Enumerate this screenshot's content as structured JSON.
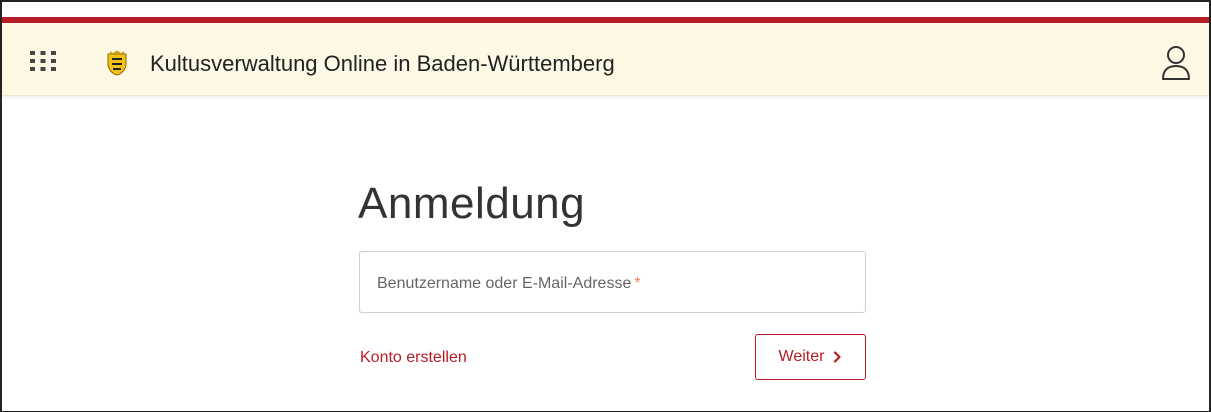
{
  "header": {
    "title": "Kultusverwaltung Online in Baden-Württemberg",
    "apps_icon": "apps-grid-icon",
    "logo_icon": "coat-of-arms-icon",
    "user_icon": "user-account-icon"
  },
  "login": {
    "title": "Anmeldung",
    "username_label": "Benutzername oder E-Mail-Adresse",
    "required_mark": "*",
    "username_value": "",
    "create_account_label": "Konto erstellen",
    "next_label": "Weiter",
    "next_icon": "chevron-right-icon"
  },
  "colors": {
    "accent": "#b71c24",
    "header_bg": "#fef9e4",
    "required": "#e6844f",
    "text": "#333333"
  }
}
